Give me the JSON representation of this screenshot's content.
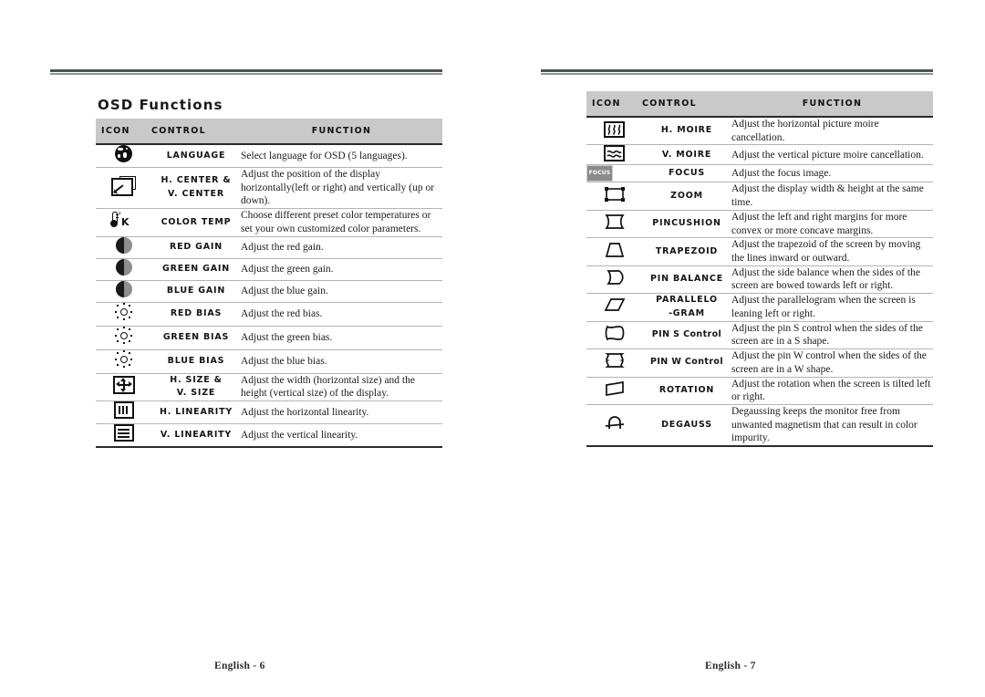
{
  "left_page": {
    "section_title": "OSD Functions",
    "columns": [
      "ICON",
      "CONTROL",
      "FUNCTION"
    ],
    "footer": "English - 6",
    "rows": [
      {
        "icon": "globe-icon",
        "control": "LANGUAGE",
        "control_line2": "",
        "function": "Select language for OSD (5 languages)."
      },
      {
        "icon": "center-position-icon",
        "control": "H. CENTER &",
        "control_line2": "V. CENTER",
        "function": "Adjust the position of the display horizontally(left or right) and vertically (up or down)."
      },
      {
        "icon": "thermometer-kelvin-icon",
        "control": "COLOR TEMP",
        "control_line2": "",
        "function": "Choose different preset color temperatures or set your own customized color parameters."
      },
      {
        "icon": "contrast-circle-icon",
        "control": "RED GAIN",
        "control_line2": "",
        "function": "Adjust the red gain."
      },
      {
        "icon": "contrast-circle-icon",
        "control": "GREEN GAIN",
        "control_line2": "",
        "function": "Adjust the green gain."
      },
      {
        "icon": "contrast-circle-icon",
        "control": "BLUE GAIN",
        "control_line2": "",
        "function": "Adjust the blue gain."
      },
      {
        "icon": "brightness-sun-icon",
        "control": "RED BIAS",
        "control_line2": "",
        "function": "Adjust the red bias."
      },
      {
        "icon": "brightness-sun-icon",
        "control": "GREEN BIAS",
        "control_line2": "",
        "function": "Adjust the green bias."
      },
      {
        "icon": "brightness-sun-icon",
        "control": "BLUE BIAS",
        "control_line2": "",
        "function": "Adjust the blue bias."
      },
      {
        "icon": "size-arrows-icon",
        "control": "H. SIZE &",
        "control_line2": "V. SIZE",
        "function": "Adjust the width (horizontal size) and the height (vertical size) of the display."
      },
      {
        "icon": "horizontal-linearity-icon",
        "control": "H. LINEARITY",
        "control_line2": "",
        "function": "Adjust the horizontal linearity."
      },
      {
        "icon": "vertical-linearity-icon",
        "control": "V. LINEARITY",
        "control_line2": "",
        "function": "Adjust the vertical linearity."
      }
    ]
  },
  "right_page": {
    "section_title": "",
    "columns": [
      "ICON",
      "CONTROL",
      "FUNCTION"
    ],
    "footer": "English - 7",
    "rows": [
      {
        "icon": "horizontal-moire-icon",
        "control": "H. MOIRE",
        "control_line2": "",
        "function": "Adjust the horizontal picture moire cancellation."
      },
      {
        "icon": "vertical-moire-icon",
        "control": "V. MOIRE",
        "control_line2": "",
        "function": "Adjust the vertical picture moire cancellation."
      },
      {
        "icon": "focus-icon",
        "control": "FOCUS",
        "control_line2": "",
        "function": "Adjust the focus image."
      },
      {
        "icon": "zoom-icon",
        "control": "ZOOM",
        "control_line2": "",
        "function": "Adjust the display width & height at the same time."
      },
      {
        "icon": "pincushion-icon",
        "control": "PINCUSHION",
        "control_line2": "",
        "function": "Adjust the left and right margins for more convex or more concave margins."
      },
      {
        "icon": "trapezoid-icon",
        "control": "TRAPEZOID",
        "control_line2": "",
        "function": "Adjust the trapezoid of the screen by moving the lines inward or outward."
      },
      {
        "icon": "pin-balance-icon",
        "control": "PIN BALANCE",
        "control_line2": "",
        "function": "Adjust the side balance when the sides of the screen are bowed towards left or right."
      },
      {
        "icon": "parallelogram-icon",
        "control": "PARALLELO",
        "control_line2": "-GRAM",
        "function": "Adjust the parallelogram when the screen is leaning left or right."
      },
      {
        "icon": "pin-s-control-icon",
        "control": "PIN S Control",
        "control_line2": "",
        "function": "Adjust the pin S control when the sides of the screen are in a S shape."
      },
      {
        "icon": "pin-w-control-icon",
        "control": "PIN W Control",
        "control_line2": "",
        "function": "Adjust the pin W control when the sides of the screen are in a W shape."
      },
      {
        "icon": "rotation-icon",
        "control": "ROTATION",
        "control_line2": "",
        "function": "Adjust the rotation when the screen is tilted left or right."
      },
      {
        "icon": "degauss-icon",
        "control": "DEGAUSS",
        "control_line2": "",
        "function": "Degaussing keeps the monitor free from unwanted magnetism that can result in color impurity."
      }
    ]
  },
  "colors": {
    "header_bar": "#c9c9c9",
    "rule_dark": "#4c5350",
    "rule_light": "#8d938f",
    "text": "#141414",
    "row_divider": "#b4b4b4"
  }
}
